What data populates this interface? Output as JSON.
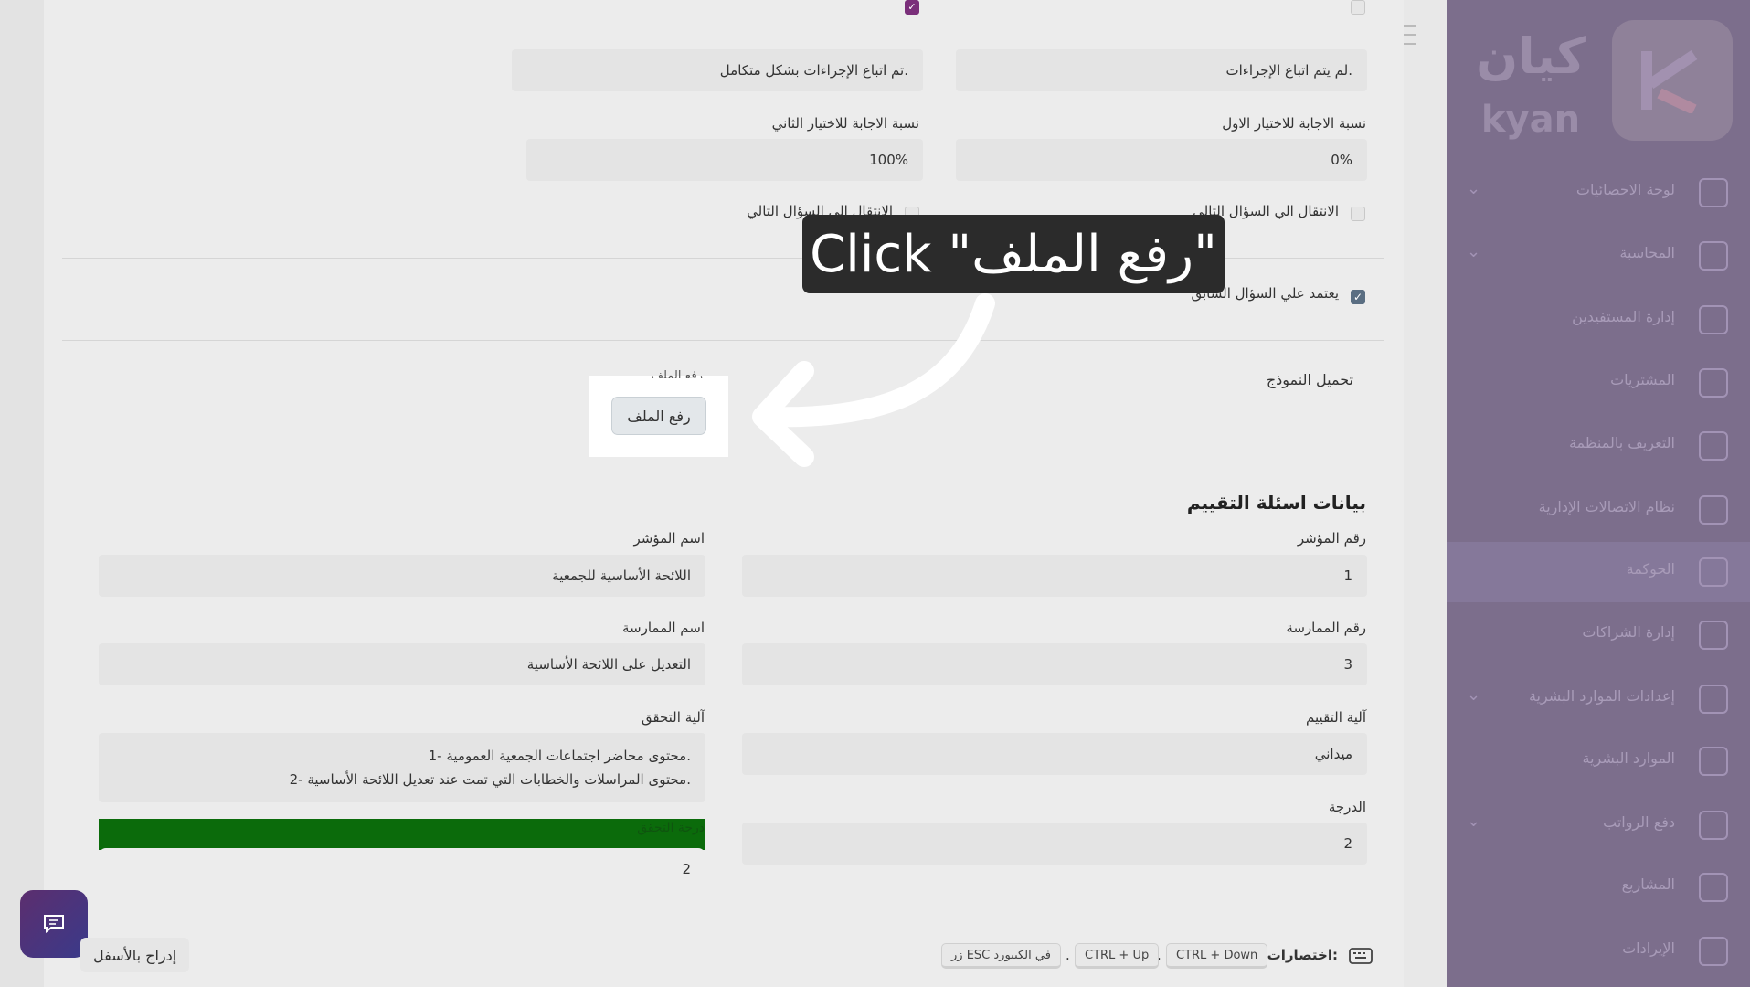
{
  "top_options": {
    "option1": "لم يتم اتباع الإجراءات.",
    "option2": "تم اتباع الإجراءات بشكل متكامل."
  },
  "ratio": {
    "first_label": "نسبة الاجابة للاختيار الاول",
    "first_value": "0%",
    "second_label": "نسبة الاجابة للاختيار الثاني",
    "second_value": "100%"
  },
  "next_question": {
    "label1": "الانتقال الي السؤال التالي",
    "label2": "الانتقال الي السؤال التالي"
  },
  "depends": {
    "label": "يعتمد علي السؤال السابق"
  },
  "upload": {
    "section_label": "تحميل النموذج",
    "partial_label": "رفع الملف",
    "button_label": "رفع الملف"
  },
  "tooltip": {
    "text": "Click \"رفع الملف\""
  },
  "eval_section": {
    "title": "بيانات اسئلة التقييم",
    "indicator_number_label": "رقم المؤشر",
    "indicator_number_value": "1",
    "indicator_name_label": "اسم المؤشر",
    "indicator_name_value": "اللائحة الأساسية للجمعية",
    "practice_number_label": "رقم الممارسة",
    "practice_number_value": "3",
    "practice_name_label": "اسم الممارسة",
    "practice_name_value": "التعديل على اللائحة الأساسية",
    "eval_mechanism_label": "آلية التقييم",
    "eval_mechanism_value": "ميداني",
    "verification_label": "آلية التحقق",
    "verification_line1": "1- محتوى محاضر اجتماعات الجمعية العمومية.",
    "verification_line2": "2- محتوى المراسلات والخطابات التي تمت عند تعديل اللائحة الأساسية.",
    "degree_label": "الدرجة",
    "degree_value": "2",
    "achieved_label": "درجة التحقق",
    "achieved_value": "2"
  },
  "shortcuts": {
    "label": "اختصارات:",
    "k1": "CTRL + Down",
    "k2": "CTRL + Up",
    "k3": "زر ESC في الكيبورد",
    "sep": "."
  },
  "insert_bottom": "إدراج بالأسفل",
  "logo": {
    "text_ar": "كيان",
    "text_en": "kyan"
  },
  "sidebar": {
    "items": [
      {
        "label": "لوحة الاحصائيات",
        "icon": "sliders-icon"
      },
      {
        "label": "المحاسبة",
        "icon": "money-icon"
      },
      {
        "label": "إدارة المستفيدين",
        "icon": "heart-icon"
      },
      {
        "label": "المشتريات",
        "icon": "bag-icon"
      },
      {
        "label": "التعريف بالمنظمة",
        "icon": "store-icon"
      },
      {
        "label": "نظام الاتصالات الإدارية",
        "icon": "arrows-icon"
      },
      {
        "label": "الحوكمة",
        "icon": "building-icon"
      },
      {
        "label": "إدارة الشراكات",
        "icon": "document-icon"
      },
      {
        "label": "إعدادات الموارد البشرية",
        "icon": "briefcase-icon"
      },
      {
        "label": "الموارد البشرية",
        "icon": "users-icon"
      },
      {
        "label": "دفع الرواتب",
        "icon": "coins-icon"
      },
      {
        "label": "المشاريع",
        "icon": "folder-icon"
      },
      {
        "label": "الإيرادات",
        "icon": "card-icon"
      }
    ]
  }
}
